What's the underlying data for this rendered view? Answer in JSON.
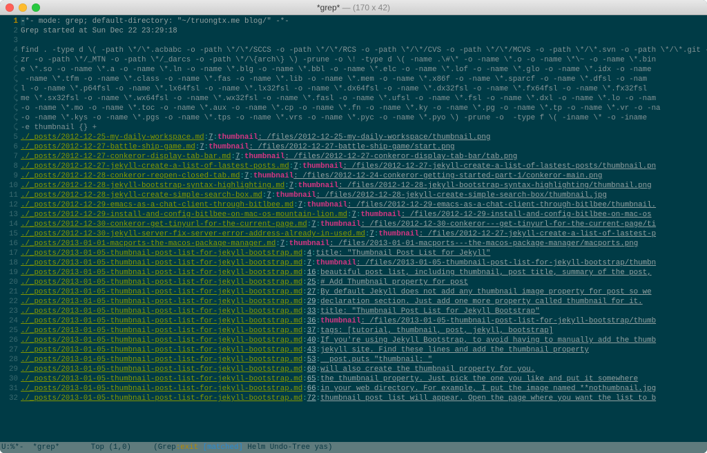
{
  "window": {
    "title_main": "*grep*",
    "title_dim": "  —  (170 x 42)"
  },
  "header0": "-*- mode: grep; default-directory: \"~/truongtx.me blog/\" -*-",
  "header1": "Grep started at Sun Dec 22 23:29:18",
  "command_lines": [
    "find . -type d \\( -path \\*/\\*.acbabc -o -path \\*/\\*/SCCS -o -path \\*/\\*/RCS -o -path \\*/\\*/CVS -o -path \\*/\\*/MCVS -o -path \\*/\\*.svn -o -path \\*/\\*.git -o -p",
    "zr -o -path \\*/_MTN -o -path \\*/_darcs -o -path \\*/\\{arch\\} \\) -prune -o \\! -type d \\( -name .\\#\\* -o -name \\*.o -o -name \\*\\~ -o -name \\*.bin",
    "e \\*.so -o -name \\*.a -o -name \\*.ln -o -name \\*.blg -o -name \\*.bbl -o -name \\*.elc -o -name \\*.lof -o -name \\*.glo -o -name \\*.idx -o -name",
    " -name \\*.tfm -o -name \\*.class -o -name \\*.fas -o -name \\*.lib -o -name \\*.mem -o -name \\*.x86f -o -name \\*.sparcf -o -name \\*.dfsl -o -nam",
    "l -o -name \\*.p64fsl -o -name \\*.lx64fsl -o -name \\*.lx32fsl -o -name \\*.dx64fsl -o -name \\*.dx32fsl -o -name \\*.fx64fsl -o -name \\*.fx32fsl",
    "me \\*.sx32fsl -o -name \\*.wx64fsl -o -name \\*.wx32fsl -o -name \\*.fasl -o -name \\*.ufsl -o -name \\*.fsl -o -name \\*.dxl -o -name \\*.lo -o -nam",
    "-o -name \\*.mo -o -name \\*.toc -o -name \\*.aux -o -name \\*.cp -o -name \\*.fn -o -name \\*.ky -o -name \\*.pg -o -name \\*.tp -o -name \\*.vr -o -na",
    "-o -name \\*.kys -o -name \\*.pgs -o -name \\*.tps -o -name \\*.vrs -o -name \\*.pyc -o -name \\*.pyo \\) -prune -o  -type f \\( -iname \\* -o -iname",
    "-e thumbnail {} +"
  ],
  "results": [
    {
      "n": 5,
      "file": "./_posts/2012-12-25-my-daily-workspace.md",
      "line": "7",
      "hit": "thumbnail",
      "rest": ": /files/2012-12-25-my-daily-workspace/thumbnail.png"
    },
    {
      "n": 6,
      "file": "./_posts/2012-12-27-battle-ship-game.md",
      "line": "7",
      "hit": "thumbnail",
      "rest": ": /files/2012-12-27-battle-ship-game/start.png"
    },
    {
      "n": 7,
      "file": "./_posts/2012-12-27-conkeror-display-tab-bar.md",
      "line": "7",
      "hit": "thumbnail",
      "rest": ": /files/2012-12-27-conkeror-display-tab-bar/tab.png"
    },
    {
      "n": 8,
      "file": "./_posts/2012-12-27-jekyll-create-a-list-of-lastest-posts.md",
      "line": "7",
      "hit": "thumbnail",
      "rest": ": /files/2012-12-27-jekyll-create-a-list-of-lastest-posts/thumbnail.pn"
    },
    {
      "n": 9,
      "file": "./_posts/2012-12-28-conkeror-reopen-closed-tab.md",
      "line": "7",
      "hit": "thumbnail",
      "rest": ": /files/2012-12-24-conkeror-getting-started-part-1/conkeror-main.png"
    },
    {
      "n": 10,
      "file": "./_posts/2012-12-28-jekyll-bootstrap-syntax-highlighting.md",
      "line": "7",
      "hit": "thumbnail",
      "rest": ": /files/2012-12-28-jekyll-bootstrap-syntax-highlighting/thumbnail.png"
    },
    {
      "n": 11,
      "file": "./_posts/2012-12-28-jekyll-create-simple-search-box.md",
      "line": "7",
      "hit": "thumbnail",
      "rest": ": /files/2012-12-28-jekyll-create-simple-search-box/thumbnail.jpg"
    },
    {
      "n": 12,
      "file": "./_posts/2012-12-29-emacs-as-a-chat-client-through-bitlbee.md",
      "line": "7",
      "hit": "thumbnail",
      "rest": ": /files/2012-12-29-emacs-as-a-chat-client-through-bitlbee/thumbnail."
    },
    {
      "n": 13,
      "file": "./_posts/2012-12-29-install-and-config-bitlbee-on-mac-os-mountain-lion.md",
      "line": "7",
      "hit": "thumbnail",
      "rest": ": /files/2012-12-29-install-and-config-bitlbee-on-mac-os"
    },
    {
      "n": 14,
      "file": "./_posts/2012-12-30-conkeror-get-tinyurl-for-the-current-page.md",
      "line": "7",
      "hit": "thumbnail",
      "rest": ": /files/2012-12-30-conkeror---get-tinyurl-for-the-current-page/ti"
    },
    {
      "n": 15,
      "file": "./_posts/2012-12-30-jekyll-server-fix-server-error-address-already-in-used.md",
      "line": "7",
      "hit": "thumbnail",
      "rest": ": /files/2012-12-27-jekyll-create-a-list-of-lastest-p"
    },
    {
      "n": 16,
      "file": "./_posts/2013-01-01-macports-the-macos-package-manager.md",
      "line": "7",
      "hit": "thumbnail",
      "rest": ": /files/2013-01-01-macports---the-macos-package-manager/macports.png"
    },
    {
      "n": 17,
      "file": "./_posts/2013-01-05-thumbnail-post-list-for-jekyll-bootstrap.md",
      "line": "4",
      "hit": "",
      "rest": "title: \"Thumbnail Post List for Jekyll\""
    },
    {
      "n": 18,
      "file": "./_posts/2013-01-05-thumbnail-post-list-for-jekyll-bootstrap.md",
      "line": "7",
      "hit": "thumbnail",
      "rest": ": /files/2013-01-05-thumbnail-post-list-for-jekyll-bootstrap/thumbn"
    },
    {
      "n": 19,
      "file": "./_posts/2013-01-05-thumbnail-post-list-for-jekyll-bootstrap.md",
      "line": "16",
      "hit": "",
      "rest": "beautiful post list, including thumbnail, post title, summary of the post,"
    },
    {
      "n": 20,
      "file": "./_posts/2013-01-05-thumbnail-post-list-for-jekyll-bootstrap.md",
      "line": "25",
      "hit": "",
      "rest": "# Add Thumbnail property for post"
    },
    {
      "n": 21,
      "file": "./_posts/2013-01-05-thumbnail-post-list-for-jekyll-bootstrap.md",
      "line": "27",
      "hit": "",
      "rest": "By default Jekyll does not add any thumbnail image property for post so we"
    },
    {
      "n": 22,
      "file": "./_posts/2013-01-05-thumbnail-post-list-for-jekyll-bootstrap.md",
      "line": "29",
      "hit": "",
      "rest": "declaration section. Just add one more property called thumbnail for it."
    },
    {
      "n": 23,
      "file": "./_posts/2013-01-05-thumbnail-post-list-for-jekyll-bootstrap.md",
      "line": "33",
      "hit": "",
      "rest": "title: \"Thumbnail Post List for Jekyll Bootstrap\""
    },
    {
      "n": 24,
      "file": "./_posts/2013-01-05-thumbnail-post-list-for-jekyll-bootstrap.md",
      "line": "36",
      "hit": "thumbnail",
      "rest": ": /files/2013-01-05-thumbnail-post-list-for-jekyll-bootstrap/thumb"
    },
    {
      "n": 25,
      "file": "./_posts/2013-01-05-thumbnail-post-list-for-jekyll-bootstrap.md",
      "line": "37",
      "hit": "",
      "rest": "tags: [tutorial, thumbnail, post, jekyll, bootstrap]"
    },
    {
      "n": 26,
      "file": "./_posts/2013-01-05-thumbnail-post-list-for-jekyll-bootstrap.md",
      "line": "40",
      "hit": "",
      "rest": "If you're using Jekyll Bootstrap, to avoid having to manually add the thumb"
    },
    {
      "n": 27,
      "file": "./_posts/2013-01-05-thumbnail-post-list-for-jekyll-bootstrap.md",
      "line": "43",
      "hit": "",
      "rest": "jekyll site. Find these lines and add the thumbnail property"
    },
    {
      "n": 28,
      "file": "./_posts/2013-01-05-thumbnail-post-list-for-jekyll-bootstrap.md",
      "line": "53",
      "hit": "",
      "rest": "  post.puts \"thumbnail: \""
    },
    {
      "n": 29,
      "file": "./_posts/2013-01-05-thumbnail-post-list-for-jekyll-bootstrap.md",
      "line": "60",
      "hit": "",
      "rest": "will also create the thumbnail property for you."
    },
    {
      "n": 30,
      "file": "./_posts/2013-01-05-thumbnail-post-list-for-jekyll-bootstrap.md",
      "line": "65",
      "hit": "",
      "rest": "the thumbnail property. Just pick the one you like and put it somewhere"
    },
    {
      "n": 31,
      "file": "./_posts/2013-01-05-thumbnail-post-list-for-jekyll-bootstrap.md",
      "line": "66",
      "hit": "",
      "rest": "in your web directory. For example, I put the image named **nothumbnail.jpg"
    },
    {
      "n": 32,
      "file": "./_posts/2013-01-05-thumbnail-post-list-for-jekyll-bootstrap.md",
      "line": "72",
      "hit": "",
      "rest": "thumbnail post list will appear. Open the page where you want the list to b"
    }
  ],
  "modeline": {
    "left": "U:%*-  *grep*       Top (1,0)     (Grep",
    "exit": ":exit ",
    "match": "[matched]",
    "right": " Helm Undo-Tree yas)"
  }
}
